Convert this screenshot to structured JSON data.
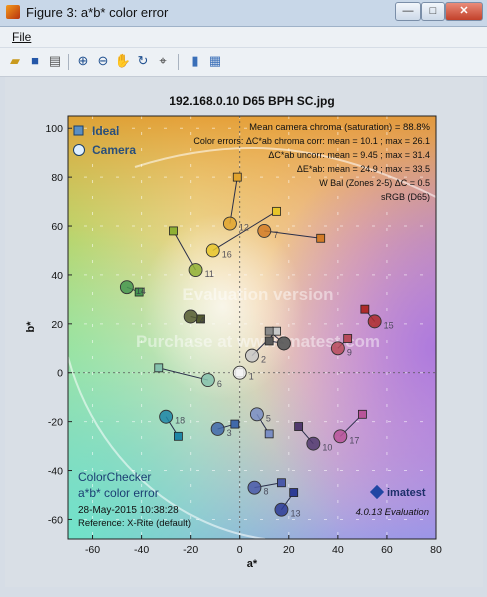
{
  "window": {
    "title": "Figure 3: a*b* color error",
    "min": "—",
    "max": "□",
    "close": "✕"
  },
  "menu": {
    "file": "File"
  },
  "toolbar": [
    "open-icon",
    "save-icon",
    "print-icon",
    "zoom-in-icon",
    "zoom-out-icon",
    "pan-icon",
    "rotate-icon",
    "data-cursor-icon",
    "colorbar-icon",
    "legend-icon"
  ],
  "chart_data": {
    "type": "scatter",
    "title": "192.168.0.10  D65 BPH SC.jpg",
    "xlabel": "a*",
    "ylabel": "b*",
    "xlim": [
      -70,
      80
    ],
    "ylim": [
      -68,
      105
    ],
    "xticks": [
      -60,
      -40,
      -20,
      0,
      20,
      40,
      60,
      80
    ],
    "yticks": [
      -60,
      -40,
      -20,
      0,
      20,
      40,
      60,
      80,
      100
    ],
    "legend": {
      "position": "top-left",
      "entries": [
        "Ideal",
        "Camera"
      ]
    },
    "stats": {
      "line1": "Mean camera chroma (saturation) = 88.8%",
      "line2": "Color errors: ΔC*ab chroma corr:  mean = 10.1 ;  max = 26.1",
      "line3": "ΔC*ab uncorr:  mean = 9.45 ;  max = 31.4",
      "line4": "ΔE*ab:  mean = 24.9 ;  max = 33.5",
      "line5": "W Bal (Zones 2-5) ΔC = 0.5",
      "line6": "sRGB (D65)"
    },
    "watermark1": "Evaluation version",
    "watermark2": "Purchase at www.imatest.com",
    "info": {
      "line1": "ColorChecker",
      "line2": "a*b* color error",
      "line3": "28-May-2015 10:38:28",
      "line4": "Reference: X-Rite (default)"
    },
    "brand": {
      "name": "imatest",
      "version": "4.0.13  Evaluation"
    },
    "points": [
      {
        "id": "1",
        "ideal": [
          0,
          0
        ],
        "camera": [
          0,
          0
        ],
        "color": "#f3f3f3"
      },
      {
        "id": "2",
        "ideal": [
          15,
          17
        ],
        "camera": [
          5,
          7
        ],
        "color": "#c8c8c8"
      },
      {
        "id": "3",
        "ideal": [
          -2,
          -21
        ],
        "camera": [
          -9,
          -23
        ],
        "color": "#4169aa"
      },
      {
        "id": "4",
        "ideal": [
          -16,
          22
        ],
        "camera": [
          -20,
          23
        ],
        "color": "#545b30"
      },
      {
        "id": "5",
        "ideal": [
          12,
          -25
        ],
        "camera": [
          7,
          -17
        ],
        "color": "#7a8ec4"
      },
      {
        "id": "6",
        "ideal": [
          -33,
          2
        ],
        "camera": [
          -13,
          -3
        ],
        "color": "#85c2ad"
      },
      {
        "id": "7",
        "ideal": [
          33,
          55
        ],
        "camera": [
          10,
          58
        ],
        "color": "#d27c28"
      },
      {
        "id": "8",
        "ideal": [
          17,
          -45
        ],
        "camera": [
          6,
          -47
        ],
        "color": "#4a59a8"
      },
      {
        "id": "9",
        "ideal": [
          44,
          14
        ],
        "camera": [
          40,
          10
        ],
        "color": "#b84c5c"
      },
      {
        "id": "10",
        "ideal": [
          24,
          -22
        ],
        "camera": [
          30,
          -29
        ],
        "color": "#513a6e"
      },
      {
        "id": "11",
        "ideal": [
          -27,
          58
        ],
        "camera": [
          -18,
          42
        ],
        "color": "#8fb034"
      },
      {
        "id": "12",
        "ideal": [
          -1,
          80
        ],
        "camera": [
          -4,
          61
        ],
        "color": "#e1a42e"
      },
      {
        "id": "13",
        "ideal": [
          22,
          -49
        ],
        "camera": [
          17,
          -56
        ],
        "color": "#2d3b95"
      },
      {
        "id": "14",
        "ideal": [
          -41,
          33
        ],
        "camera": [
          -46,
          35
        ],
        "color": "#469650"
      },
      {
        "id": "15",
        "ideal": [
          51,
          26
        ],
        "camera": [
          55,
          21
        ],
        "color": "#ae2b2b"
      },
      {
        "id": "16",
        "ideal": [
          15,
          66
        ],
        "camera": [
          -11,
          50
        ],
        "color": "#e7c52a"
      },
      {
        "id": "17",
        "ideal": [
          50,
          -17
        ],
        "camera": [
          41,
          -26
        ],
        "color": "#b85499"
      },
      {
        "id": "18",
        "ideal": [
          -25,
          -26
        ],
        "camera": [
          -30,
          -18
        ],
        "color": "#1f86a6"
      },
      {
        "id": "",
        "ideal": [
          12,
          17
        ],
        "camera": [
          18,
          12
        ],
        "color": "#8a8a8a"
      },
      {
        "id": "",
        "ideal": [
          12,
          13
        ],
        "camera": [
          18,
          12
        ],
        "color": "#5a5a5a"
      }
    ]
  }
}
